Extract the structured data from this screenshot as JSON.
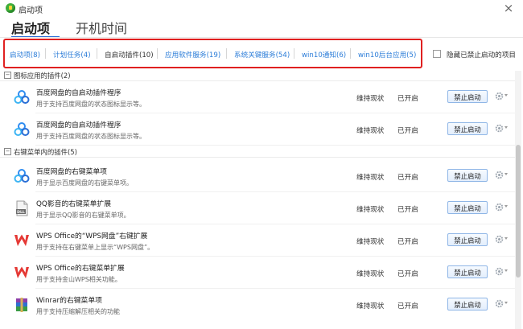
{
  "window": {
    "title": "启动项"
  },
  "tabs": [
    {
      "label": "启动项",
      "active": true
    },
    {
      "label": "开机时间",
      "active": false
    }
  ],
  "filters": [
    {
      "label": "启动项(8)",
      "style": "link"
    },
    {
      "label": "计划任务(4)",
      "style": "link"
    },
    {
      "label": "自启动插件(10)",
      "style": "plain"
    },
    {
      "label": "应用软件服务(19)",
      "style": "link"
    },
    {
      "label": "系统关键服务(54)",
      "style": "link"
    },
    {
      "label": "win10通知(6)",
      "style": "link"
    },
    {
      "label": "win10后台应用(5)",
      "style": "link"
    }
  ],
  "hide_disabled": {
    "label": "隐藏已禁止启动的项目",
    "checked": false
  },
  "groups": [
    {
      "title": "图标应用的插件(2)",
      "toggle": "−",
      "items": [
        {
          "name": "百度网盘的自启动插件程序",
          "desc": "用于支持百度网盘的状态图标显示等。",
          "icon": "baidu-netdisk-icon",
          "status": "维持现状",
          "state": "已开启",
          "button": "禁止启动"
        },
        {
          "name": "百度网盘的自启动插件程序",
          "desc": "用于支持百度网盘的状态图标显示等。",
          "icon": "baidu-netdisk-icon",
          "status": "维持现状",
          "state": "已开启",
          "button": "禁止启动"
        }
      ]
    },
    {
      "title": "右键菜单内的插件(5)",
      "toggle": "−",
      "items": [
        {
          "name": "百度网盘的右键菜单项",
          "desc": "用于显示百度网盘的右键菜单项。",
          "icon": "baidu-netdisk-icon",
          "status": "维持现状",
          "state": "已开启",
          "button": "禁止启动"
        },
        {
          "name": "QQ影音的右键菜单扩展",
          "desc": "用于显示QQ影音的右键菜单项。",
          "icon": "dll-file-icon",
          "status": "维持现状",
          "state": "已开启",
          "button": "禁止启动"
        },
        {
          "name": "WPS Office的“WPS网盘”右键扩展",
          "desc": "用于支持在右键菜单上显示“WPS网盘”。",
          "icon": "wps-office-icon",
          "status": "维持现状",
          "state": "已开启",
          "button": "禁止启动"
        },
        {
          "name": "WPS Office的右键菜单扩展",
          "desc": "用于支持金山WPS相关功能。",
          "icon": "wps-office-icon",
          "status": "维持现状",
          "state": "已开启",
          "button": "禁止启动"
        },
        {
          "name": "Winrar的右键菜单项",
          "desc": "用于支持压缩解压相关的功能",
          "icon": "winrar-icon",
          "status": "维持现状",
          "state": "已开启",
          "button": "禁止启动"
        }
      ]
    }
  ],
  "colors": {
    "accent": "#2a6fd6",
    "link": "#2b7cd8",
    "highlight_border": "#e02020",
    "wps_red": "#e53935"
  }
}
